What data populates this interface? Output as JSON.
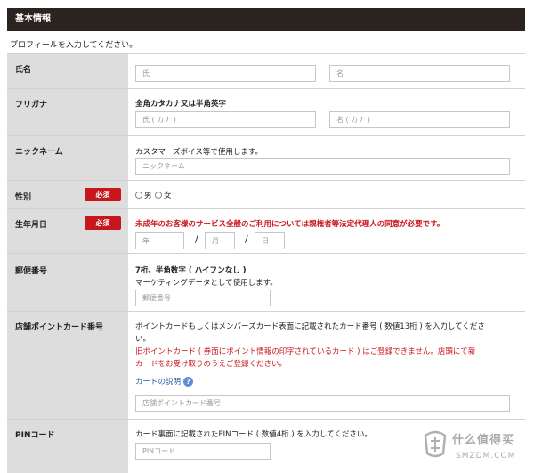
{
  "header": {
    "title": "基本情報"
  },
  "intro": "プロフィールを入力してください。",
  "badges": {
    "required": "必須"
  },
  "name": {
    "label": "氏名",
    "last_placeholder": "氏",
    "first_placeholder": "名"
  },
  "furigana": {
    "label": "フリガナ",
    "note": "全角カタカナ又は半角英字",
    "last_placeholder": "氏 ( カナ )",
    "first_placeholder": "名 ( カナ )"
  },
  "nickname": {
    "label": "ニックネーム",
    "note": "カスタマーズボイス等で使用します。",
    "placeholder": "ニックネーム"
  },
  "gender": {
    "label": "性別",
    "options": [
      "男",
      "女"
    ]
  },
  "birthday": {
    "label": "生年月日",
    "notice": "未成年のお客様のサービス全般のご利用については親権者等法定代理人の同意が必要です。",
    "year_placeholder": "年",
    "month_placeholder": "月",
    "day_placeholder": "日",
    "separator": "/"
  },
  "postal": {
    "label": "郵便番号",
    "note_bold": "7桁、半角数字 ( ハイフンなし )",
    "note": "マーケティングデータとして使用します。",
    "placeholder": "郵便番号"
  },
  "point_card": {
    "label": "店舗ポイントカード番号",
    "note_line1": "ポイントカードもしくはメンバーズカード表面に記載されたカード番号 ( 数値13桁 ) を入力してくださ",
    "note_line2": "い。",
    "warning_line1": "旧ポイントカード ( 券面にポイント情報の印字されているカード ) はご登録できません。店頭にて新",
    "warning_line2": "カードをお受け取りのうえご登録ください。",
    "help_link": "カードの説明",
    "help_icon": "?",
    "placeholder": "店舗ポイントカード番号"
  },
  "pin": {
    "label": "PINコード",
    "note": "カード裏面に記載されたPINコード ( 数値4桁 ) を入力してください。",
    "placeholder": "PINコード"
  },
  "watermark": {
    "name": "什么值得买",
    "url": "SMZDM.COM"
  },
  "colors": {
    "header_bg": "#2b2320",
    "label_bg": "#dddddd",
    "required": "#c8161d",
    "link": "#1f5ea8"
  }
}
